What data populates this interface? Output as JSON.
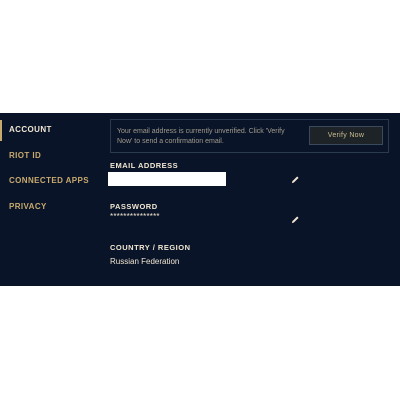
{
  "sidebar": {
    "items": [
      {
        "label": "ACCOUNT"
      },
      {
        "label": "RIOT ID"
      },
      {
        "label": "CONNECTED APPS"
      },
      {
        "label": "PRIVACY"
      }
    ]
  },
  "notice": {
    "message": "Your email address is currently unverified. Click 'Verify Now' to send a confirmation email.",
    "button_label": "Verify Now"
  },
  "email": {
    "label": "EMAIL ADDRESS",
    "value": ""
  },
  "password": {
    "label": "PASSWORD",
    "value": "***************"
  },
  "country": {
    "label": "COUNTRY / REGION",
    "value": "Russian Federation"
  },
  "colors": {
    "background": "#0a1428",
    "gold": "#c8aa6e",
    "text_light": "#f0e6d2"
  }
}
